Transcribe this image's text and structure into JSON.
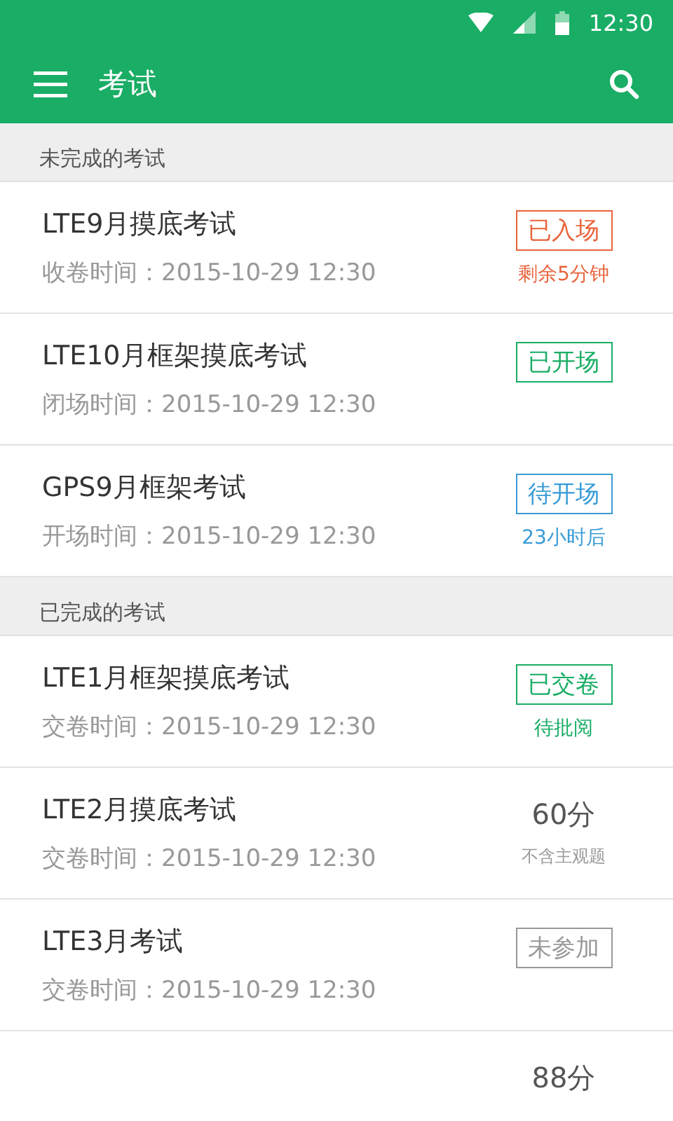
{
  "status_bar": {
    "time": "12:30"
  },
  "app_bar": {
    "title": "考试"
  },
  "sections": [
    {
      "title": "未完成的考试",
      "items": [
        {
          "title": "LTE9月摸底考试",
          "time": "收卷时间：2015-10-29  12:30",
          "kind": "tag",
          "tag": "已入场",
          "color": "#e8643c",
          "note": "剩余5分钟"
        },
        {
          "title": "LTE10月框架摸底考试",
          "time": "闭场时间：2015-10-29  12:30",
          "kind": "tag",
          "tag": "已开场",
          "color": "#1aad65"
        },
        {
          "title": "GPS9月框架考试",
          "time": "开场时间：2015-10-29  12:30",
          "kind": "tag",
          "tag": "待开场",
          "color": "#3a9bd6",
          "note": "23小时后"
        }
      ]
    },
    {
      "title": "已完成的考试",
      "items": [
        {
          "title": "LTE1月框架摸底考试",
          "time": "交卷时间：2015-10-29  12:30",
          "kind": "tag",
          "tag": "已交卷",
          "color": "#1aad65",
          "note": "待批阅"
        },
        {
          "title": "LTE2月摸底考试",
          "time": "交卷时间：2015-10-29  12:30",
          "kind": "score",
          "score": "60分",
          "note": "不含主观题"
        },
        {
          "title": "LTE3月考试",
          "time": "交卷时间：2015-10-29  12:30",
          "kind": "tag",
          "tag": "未参加",
          "color": "#999999"
        },
        {
          "kind": "score",
          "score": "88分"
        }
      ]
    }
  ]
}
